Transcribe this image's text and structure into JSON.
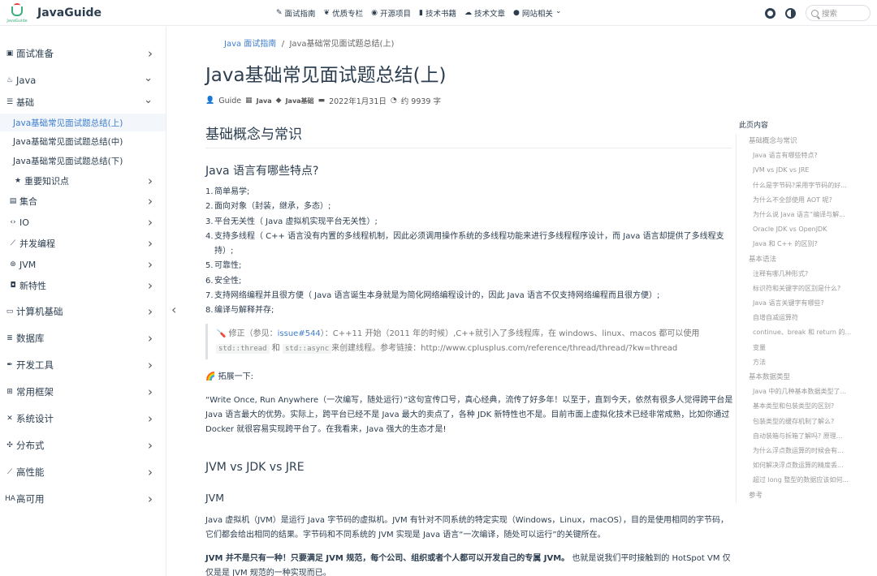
{
  "brand": {
    "title": "JavaGuide",
    "logo_caption": "JavaGuide"
  },
  "nav": [
    {
      "icon": "pen-icon",
      "label": "面试指南",
      "glyph": "✎"
    },
    {
      "icon": "flame-icon",
      "label": "优质专栏",
      "glyph": "❦"
    },
    {
      "icon": "github-icon",
      "label": "开源项目",
      "glyph": "◉"
    },
    {
      "icon": "book-icon",
      "label": "技术书籍",
      "glyph": "▮"
    },
    {
      "icon": "cloud-icon",
      "label": "技术文章",
      "glyph": "☁"
    },
    {
      "icon": "info-icon",
      "label": "网站相关",
      "glyph": "●"
    }
  ],
  "search": {
    "placeholder": "搜索"
  },
  "sidebar": {
    "items": [
      {
        "label": "面试准备",
        "icon": "calendar-icon",
        "glyph": "▣",
        "type": "group",
        "state": "collapsed"
      },
      {
        "label": "Java",
        "icon": "java-icon",
        "glyph": "♨",
        "type": "group",
        "state": "expanded"
      },
      {
        "label": "基础",
        "icon": "sliders-icon",
        "glyph": "☰",
        "type": "sub",
        "state": "expanded"
      },
      {
        "label": "Java基础常见面试题总结(上)",
        "type": "leaf",
        "active": true
      },
      {
        "label": "Java基础常见面试题总结(中)",
        "type": "leaf"
      },
      {
        "label": "Java基础常见面试题总结(下)",
        "type": "leaf"
      },
      {
        "label": "重要知识点",
        "icon": "star-icon",
        "glyph": "★",
        "type": "sub",
        "state": "collapsed"
      },
      {
        "label": "集合",
        "icon": "box-icon",
        "glyph": "▤",
        "type": "sub",
        "state": "collapsed"
      },
      {
        "label": "IO",
        "icon": "code-icon",
        "glyph": "‹›",
        "type": "sub",
        "state": "collapsed"
      },
      {
        "label": "并发编程",
        "icon": "chart-icon",
        "glyph": "⟋",
        "type": "sub",
        "state": "collapsed"
      },
      {
        "label": "JVM",
        "icon": "jvm-icon",
        "glyph": "⊛",
        "type": "sub",
        "state": "collapsed"
      },
      {
        "label": "新特性",
        "icon": "bookmark-icon",
        "glyph": "◘",
        "type": "sub",
        "state": "collapsed"
      },
      {
        "label": "计算机基础",
        "icon": "monitor-icon",
        "glyph": "▭",
        "type": "group",
        "state": "collapsed"
      },
      {
        "label": "数据库",
        "icon": "database-icon",
        "glyph": "≣",
        "type": "group",
        "state": "collapsed"
      },
      {
        "label": "开发工具",
        "icon": "wrench-icon",
        "glyph": "✒",
        "type": "group",
        "state": "collapsed"
      },
      {
        "label": "常用框架",
        "icon": "sitemap-icon",
        "glyph": "⊞",
        "type": "group",
        "state": "collapsed"
      },
      {
        "label": "系统设计",
        "icon": "design-icon",
        "glyph": "✕",
        "type": "group",
        "state": "collapsed"
      },
      {
        "label": "分布式",
        "icon": "network-icon",
        "glyph": "✣",
        "type": "group",
        "state": "collapsed"
      },
      {
        "label": "高性能",
        "icon": "perf-icon",
        "glyph": "⟋",
        "type": "group",
        "state": "collapsed"
      },
      {
        "label": "高可用",
        "icon": "ha-icon",
        "glyph": "HA",
        "type": "group",
        "state": "collapsed"
      }
    ]
  },
  "breadcrumb": {
    "parent": "Java 面试指南",
    "sep": "/",
    "current": "Java基础常见面试题总结(上)"
  },
  "article": {
    "title": "Java基础常见面试题总结(上)",
    "meta": {
      "author": "Guide",
      "category": "Java",
      "tag": "Java基础",
      "date": "2022年1月31日",
      "words": "约 9939 字"
    },
    "h2_basic": "基础概念与常识",
    "h3_features": "Java 语言有哪些特点?",
    "features": [
      "简单易学;",
      "面向对象（封装，继承，多态）;",
      "平台无关性（ Java 虚拟机实现平台无关性）;",
      "支持多线程（ C++ 语言没有内置的多线程机制，因此必须调用操作系统的多线程功能来进行多线程程序设计，而 Java 语言却提供了多线程支持）;",
      "可靠性;",
      "安全性;",
      "支持网络编程并且很方便（ Java 语言诞生本身就是为简化网络编程设计的，因此 Java 语言不仅支持网络编程而且很方便）;",
      "编译与解释并存;"
    ],
    "quote": {
      "prefix": "🪛 修正（参见：",
      "link": "issue#544",
      "after_link": "）：C++11 开始（2011 年的时候）,C++就引入了多线程库，在 windows、linux、macos 都可以使用",
      "code1": "std::thread",
      "mid": "和",
      "code2": "std::async",
      "suffix": "来创建线程。参考链接：http://www.cplusplus.com/reference/thread/thread/?kw=thread"
    },
    "expand_label": "🌈 拓展一下:",
    "expand_text": "“Write Once, Run Anywhere（一次编写，随处运行）”这句宣传口号，真心经典，流传了好多年！以至于，直到今天，依然有很多人觉得跨平台是 Java 语言最大的优势。实际上，跨平台已经不是 Java 最大的卖点了，各种 JDK 新特性也不是。目前市面上虚拟化技术已经非常成熟，比如你通过 Docker 就很容易实现跨平台了。在我看来，Java 强大的生态才是!",
    "h3_jvm": "JVM vs JDK vs JRE",
    "h4_jvm": "JVM",
    "jvm_text": "Java 虚拟机（JVM）是运行 Java 字节码的虚拟机。JVM 有针对不同系统的特定实现（Windows，Linux，macOS），目的是使用相同的字节码，它们都会给出相同的结果。字节码和不同系统的 JVM 实现是 Java 语言“一次编译，随处可以运行”的关键所在。",
    "jvm_bold": "JVM 并不是只有一种！只要满足 JVM 规范，每个公司、组织或者个人都可以开发自己的专属 JVM。",
    "jvm_rest": " 也就是说我们平时接触到的 HotSpot VM 仅仅是是 JVM 规范的一种实现而已。"
  },
  "toc": {
    "title": "此页内容",
    "items": [
      {
        "label": "基础概念与常识",
        "level": 1
      },
      {
        "label": "Java 语言有哪些特点?",
        "level": 2
      },
      {
        "label": "JVM vs JDK vs JRE",
        "level": 2
      },
      {
        "label": "什么是字节码?采用字节码的好...",
        "level": 2
      },
      {
        "label": "为什么不全部使用 AOT 呢?",
        "level": 2
      },
      {
        "label": "为什么说 Java 语言“编译与解...",
        "level": 2
      },
      {
        "label": "Oracle JDK vs OpenJDK",
        "level": 2
      },
      {
        "label": "Java 和 C++ 的区别?",
        "level": 2
      },
      {
        "label": "基本语法",
        "level": 1
      },
      {
        "label": "注释有哪几种形式?",
        "level": 2
      },
      {
        "label": "标识符和关键字的区别是什么?",
        "level": 2
      },
      {
        "label": "Java 语言关键字有哪些?",
        "level": 2
      },
      {
        "label": "自增自减运算符",
        "level": 2
      },
      {
        "label": "continue、break 和 return 的...",
        "level": 2
      },
      {
        "label": "变量",
        "level": 2
      },
      {
        "label": "方法",
        "level": 2
      },
      {
        "label": "基本数据类型",
        "level": 1
      },
      {
        "label": "Java 中的几种基本数据类型了...",
        "level": 2
      },
      {
        "label": "基本类型和包装类型的区别?",
        "level": 2
      },
      {
        "label": "包装类型的缓存机制了解么?",
        "level": 2
      },
      {
        "label": "自动装箱与拆箱了解吗? 原理...",
        "level": 2
      },
      {
        "label": "为什么浮点数运算的时候会有...",
        "level": 2
      },
      {
        "label": "如何解决浮点数运算的精度丢...",
        "level": 2
      },
      {
        "label": "超过 long 整型的数据应该如何...",
        "level": 2
      },
      {
        "label": "参考",
        "level": 1
      }
    ]
  }
}
